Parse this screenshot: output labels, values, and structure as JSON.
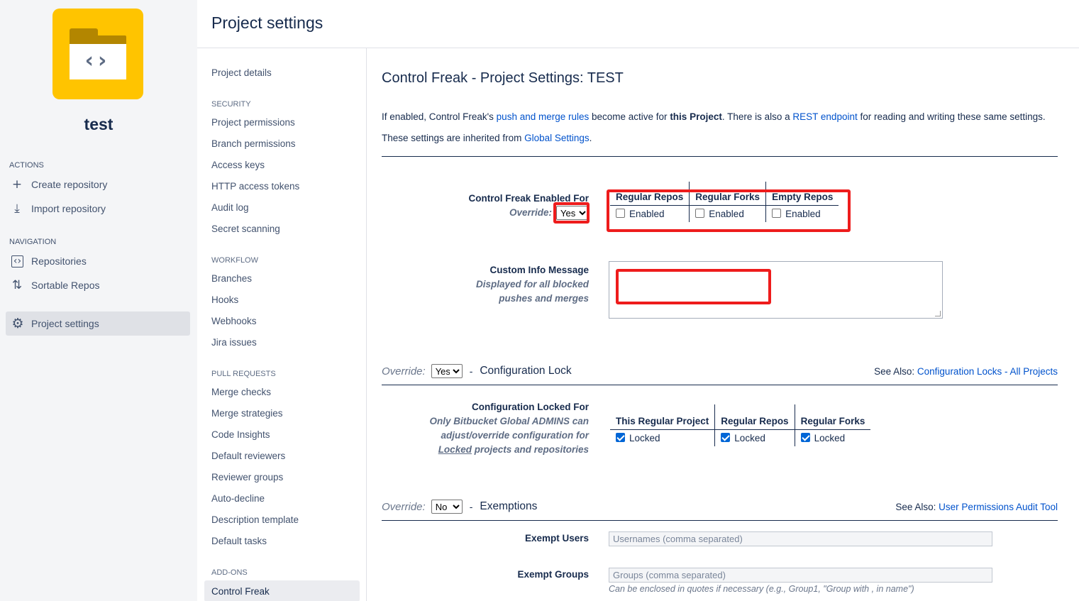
{
  "project": {
    "name": "test"
  },
  "sidebar": {
    "actions_heading": "ACTIONS",
    "actions": [
      {
        "label": "Create repository",
        "icon": "plus-icon"
      },
      {
        "label": "Import repository",
        "icon": "import-icon"
      }
    ],
    "navigation_heading": "NAVIGATION",
    "navigation": [
      {
        "label": "Repositories",
        "icon": "repository-icon"
      },
      {
        "label": "Sortable Repos",
        "icon": "sort-icon"
      }
    ],
    "active": {
      "label": "Project settings",
      "icon": "gear-icon"
    }
  },
  "header": {
    "title": "Project settings"
  },
  "settings_nav": {
    "top_item": "Project details",
    "sections": [
      {
        "heading": "SECURITY",
        "items": [
          "Project permissions",
          "Branch permissions",
          "Access keys",
          "HTTP access tokens",
          "Audit log",
          "Secret scanning"
        ]
      },
      {
        "heading": "WORKFLOW",
        "items": [
          "Branches",
          "Hooks",
          "Webhooks",
          "Jira issues"
        ]
      },
      {
        "heading": "PULL REQUESTS",
        "items": [
          "Merge checks",
          "Merge strategies",
          "Code Insights",
          "Default reviewers",
          "Reviewer groups",
          "Auto-decline",
          "Description template",
          "Default tasks"
        ]
      },
      {
        "heading": "ADD-ONS",
        "items": [
          "Control Freak"
        ]
      }
    ]
  },
  "main": {
    "title": "Control Freak - Project Settings: TEST",
    "intro": {
      "p1_a": "If enabled, Control Freak's ",
      "p1_link1": "push and merge rules",
      "p1_b": " become active for ",
      "p1_bold": "this Project",
      "p1_c": ". There is also a ",
      "p1_link2": "REST endpoint",
      "p1_d": " for reading and writing these same settings.",
      "p2_a": "These settings are inherited from ",
      "p2_link": "Global Settings",
      "p2_b": "."
    },
    "enabled_for": {
      "label": "Control Freak Enabled For",
      "override_label": "Override:",
      "override_value": "Yes",
      "columns": [
        "Regular Repos",
        "Regular Forks",
        "Empty Repos"
      ],
      "checkbox_label": "Enabled",
      "checked": [
        false,
        false,
        false
      ]
    },
    "custom_info": {
      "label": "Custom Info Message",
      "sub1": "Displayed for all blocked",
      "sub2": "pushes and merges",
      "value": ""
    },
    "config_lock": {
      "override_label": "Override:",
      "override_value": "Yes",
      "dash": "-",
      "title": "Configuration Lock",
      "see_also_label": "See Also: ",
      "see_also_link": "Configuration Locks - All Projects",
      "label": "Configuration Locked For",
      "sub1": "Only Bitbucket Global ADMINS can",
      "sub2": "adjust/override configuration for",
      "sub3_u": "Locked",
      "sub3_rest": " projects and repositories",
      "columns": [
        "This Regular Project",
        "Regular Repos",
        "Regular Forks"
      ],
      "checkbox_label": "Locked",
      "checked": [
        true,
        true,
        true
      ]
    },
    "exemptions": {
      "override_label": "Override:",
      "override_value": "No",
      "dash": "-",
      "title": "Exemptions",
      "see_also_label": "See Also: ",
      "see_also_link": "User Permissions Audit Tool",
      "users_label": "Exempt Users",
      "users_placeholder": "Usernames (comma separated)",
      "groups_label": "Exempt Groups",
      "groups_placeholder": "Groups (comma separated)",
      "groups_hint": "Can be enclosed in quotes if necessary (e.g., Group1, \"Group with , in name\")"
    },
    "select_options": [
      "Yes",
      "No"
    ]
  },
  "colors": {
    "accent": "#0052cc",
    "highlight": "#ee1c1c",
    "logo": "#ffc400"
  }
}
